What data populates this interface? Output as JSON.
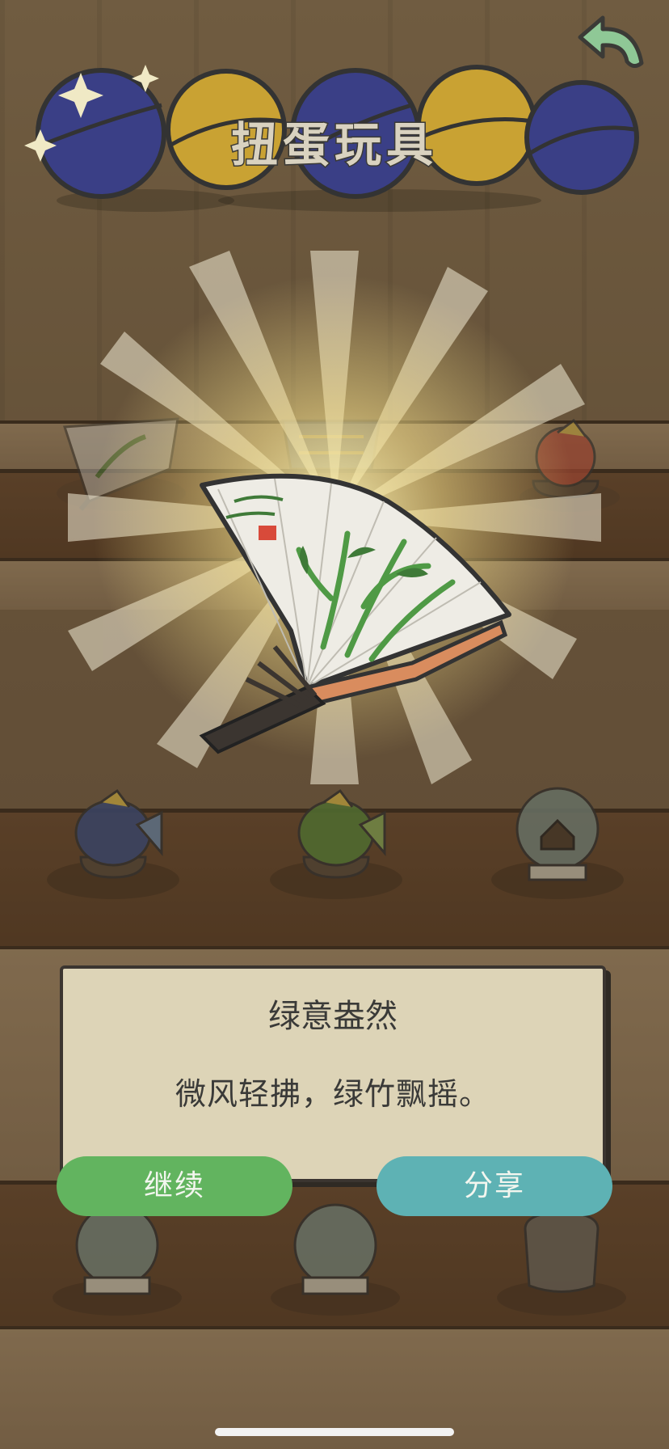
{
  "header": {
    "title": "扭蛋玩具",
    "back_icon": "back-arrow-icon"
  },
  "featured_item": {
    "icon": "folding-fan-bamboo-icon"
  },
  "shelf_items": [
    {
      "icon": "folding-fan-icon"
    },
    {
      "icon": "blue-fan-icon"
    },
    {
      "icon": "red-fish-bowl-icon"
    },
    {
      "icon": "blue-fish-bowl-icon"
    },
    {
      "icon": "green-fish-bowl-icon"
    },
    {
      "icon": "house-snow-globe-icon"
    },
    {
      "icon": "fish-snow-globe-icon"
    },
    {
      "icon": "boat-snow-globe-icon"
    },
    {
      "icon": "jar-icon"
    }
  ],
  "dialog": {
    "title": "绿意盎然",
    "description": "微风轻拂，绿竹飘摇。"
  },
  "buttons": {
    "continue": "继续",
    "share": "分享"
  },
  "colors": {
    "continue_button": "#62b45f",
    "share_button": "#5eb2b4",
    "dialog_bg": "#ddd4b7",
    "navy_ball": "#3a3f86",
    "gold_ball": "#c9a233"
  }
}
